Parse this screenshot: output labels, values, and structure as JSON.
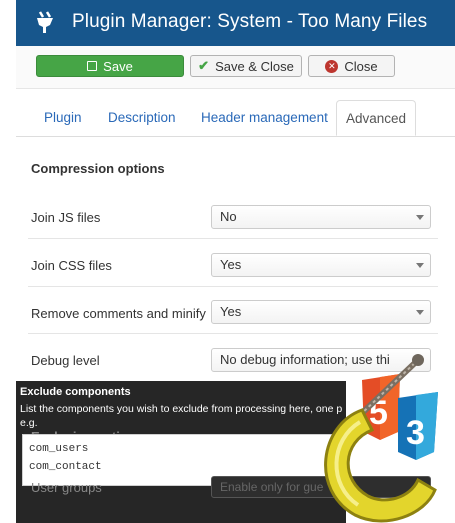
{
  "header": {
    "title": "Plugin Manager: System - Too Many Files"
  },
  "toolbar": {
    "save_label": "Save",
    "save_close_label": "Save & Close",
    "close_label": "Close"
  },
  "tabs": [
    "Plugin",
    "Description",
    "Header management",
    "Advanced"
  ],
  "section": {
    "compression_title": "Compression options"
  },
  "fields": [
    {
      "label": "Join JS files",
      "value": "No"
    },
    {
      "label": "Join CSS files",
      "value": "Yes"
    },
    {
      "label": "Remove comments and minify",
      "value": "Yes"
    },
    {
      "label": "Debug level",
      "value": "No debug information; use thi"
    }
  ],
  "tooltip": {
    "title": "Exclude components",
    "text": "List the components you wish to exclude from processing here, one per line,",
    "text2": "e.g."
  },
  "background": {
    "exclusion_title": "Exclusion options",
    "user_groups_label": "User groups",
    "user_groups_value": "Enable only for gue"
  },
  "exclude_components": {
    "line1": "com_users",
    "line2": "com_contact"
  },
  "icons": {
    "plugin": "plug-icon",
    "save": "save-icon",
    "check": "check-icon",
    "close": "close-icon",
    "logo": "clamp-html5-css3-logo"
  },
  "colors": {
    "header": "#17568c",
    "save_button": "#46a546",
    "close_icon": "#bd362f",
    "tooltip": "#262626",
    "link": "#2a69b8"
  }
}
